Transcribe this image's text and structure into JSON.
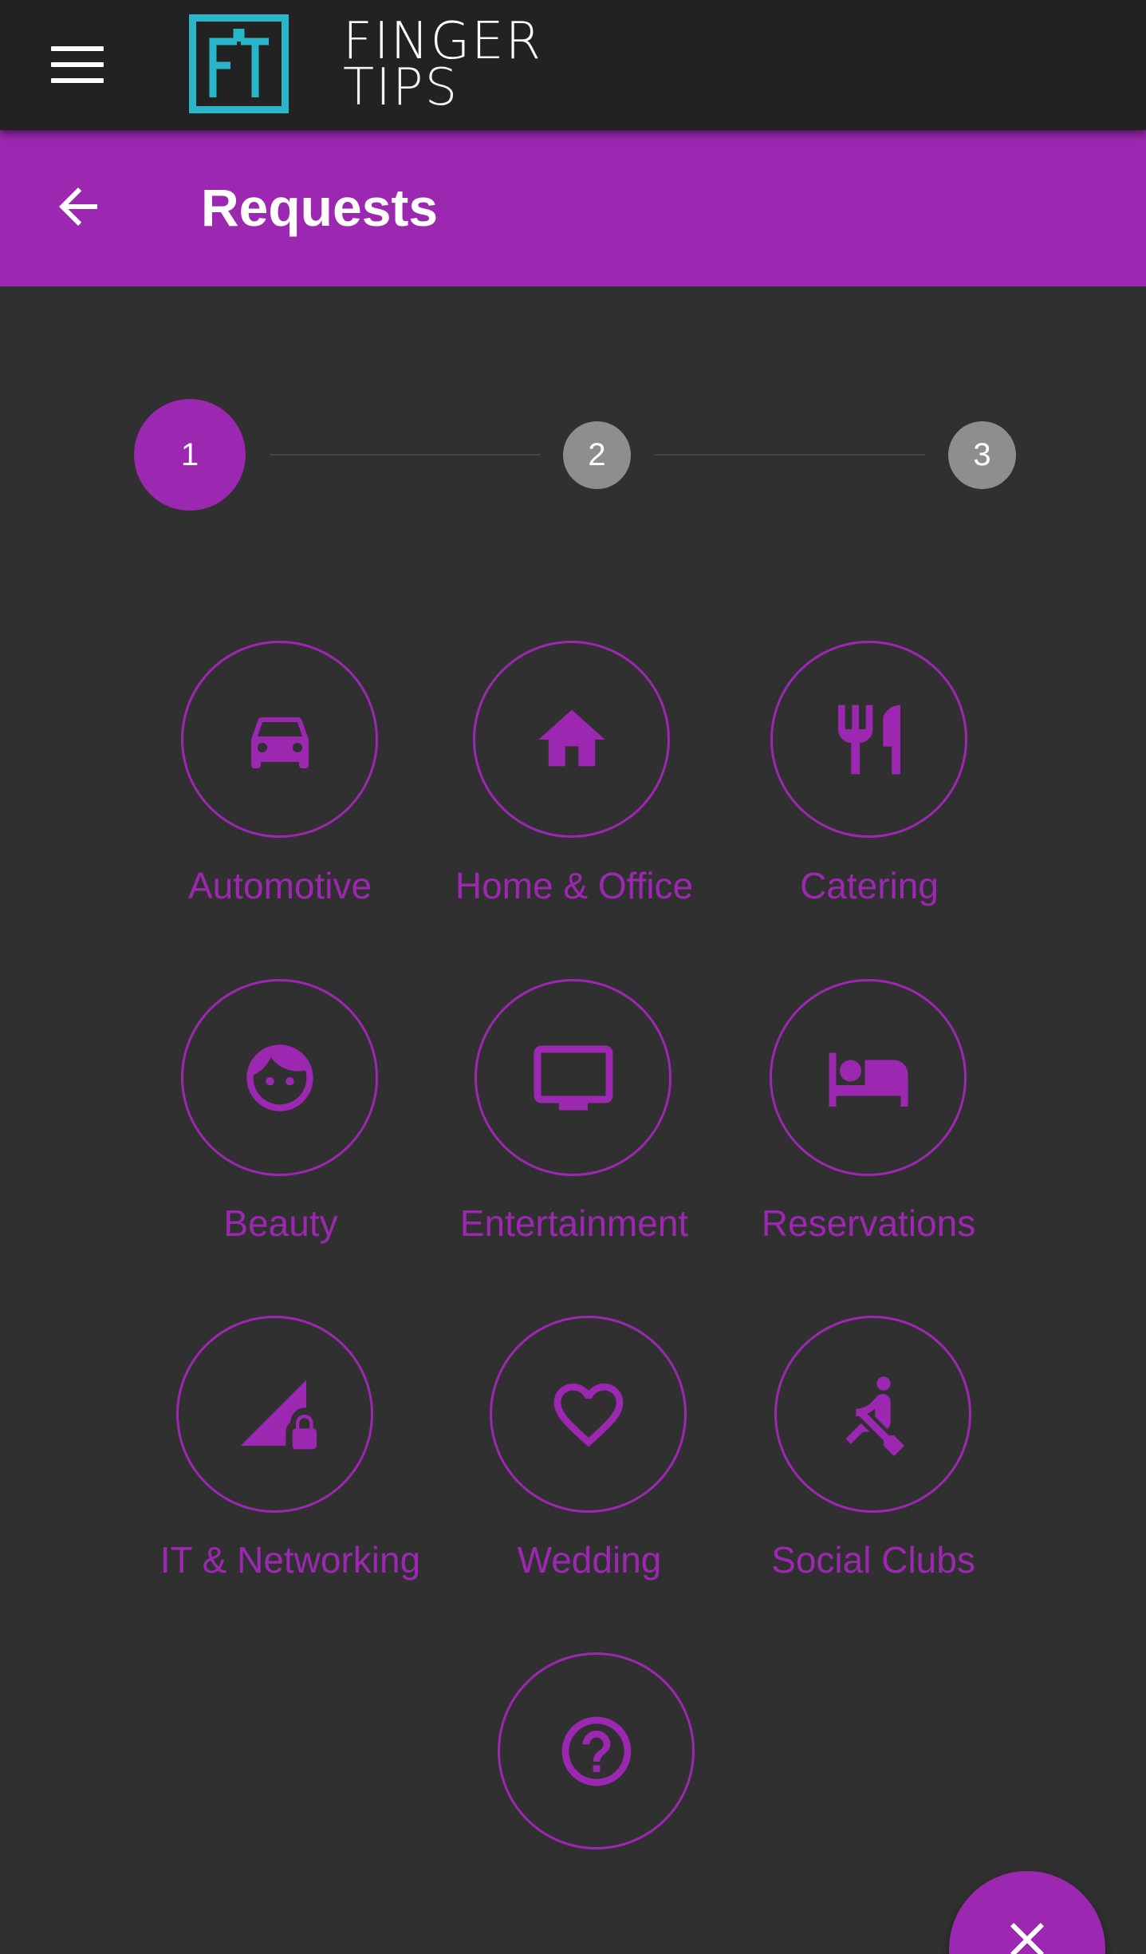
{
  "app": {
    "logo_line1": "FINGER",
    "logo_line2": "TIPS",
    "logo_colors": {
      "mark": "#29b6c8"
    }
  },
  "header": {
    "title": "Requests",
    "background": "#9c27b0"
  },
  "stepper": {
    "steps": [
      "1",
      "2",
      "3"
    ],
    "active_step": 1,
    "active_color": "#9c27b0",
    "inactive_color": "#8e8e8e"
  },
  "categories": [
    {
      "label": "Automotive",
      "icon": "car-icon"
    },
    {
      "label": "Home & Office",
      "icon": "home-icon"
    },
    {
      "label": "Catering",
      "icon": "restaurant-icon"
    },
    {
      "label": "Beauty",
      "icon": "face-icon"
    },
    {
      "label": "Entertainment",
      "icon": "tv-icon"
    },
    {
      "label": "Reservations",
      "icon": "hotel-bed-icon"
    },
    {
      "label": "IT & Networking",
      "icon": "signal-lock-icon"
    },
    {
      "label": "Wedding",
      "icon": "heart-icon"
    },
    {
      "label": "Social Clubs",
      "icon": "rowing-icon"
    },
    {
      "label": "",
      "icon": "help-icon"
    }
  ],
  "fab": {
    "icon": "close-icon"
  },
  "colors": {
    "accent": "#9c27b0",
    "background": "#303030",
    "topbar": "#222222"
  }
}
